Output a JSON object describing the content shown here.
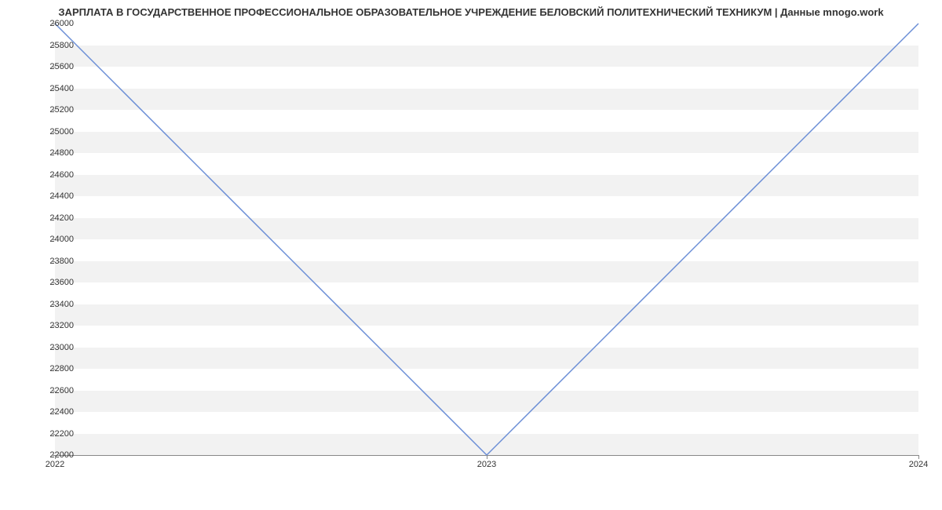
{
  "chart_data": {
    "type": "line",
    "title": "ЗАРПЛАТА В ГОСУДАРСТВЕННОЕ ПРОФЕССИОНАЛЬНОЕ ОБРАЗОВАТЕЛЬНОЕ УЧРЕЖДЕНИЕ   БЕЛОВСКИЙ ПОЛИТЕХНИЧЕСКИЙ ТЕХНИКУМ | Данные mnogo.work",
    "x": [
      "2022",
      "2023",
      "2024"
    ],
    "values": [
      26000,
      22000,
      26000
    ],
    "xlabel": "",
    "ylabel": "",
    "ylim": [
      22000,
      26000
    ],
    "y_ticks": [
      22000,
      22200,
      22400,
      22600,
      22800,
      23000,
      23200,
      23400,
      23600,
      23800,
      24000,
      24200,
      24400,
      24600,
      24800,
      25000,
      25200,
      25400,
      25600,
      25800,
      26000
    ],
    "x_ticks": [
      "2022",
      "2023",
      "2024"
    ]
  },
  "colors": {
    "line": "#6b8ed6",
    "band": "#f2f2f2"
  }
}
